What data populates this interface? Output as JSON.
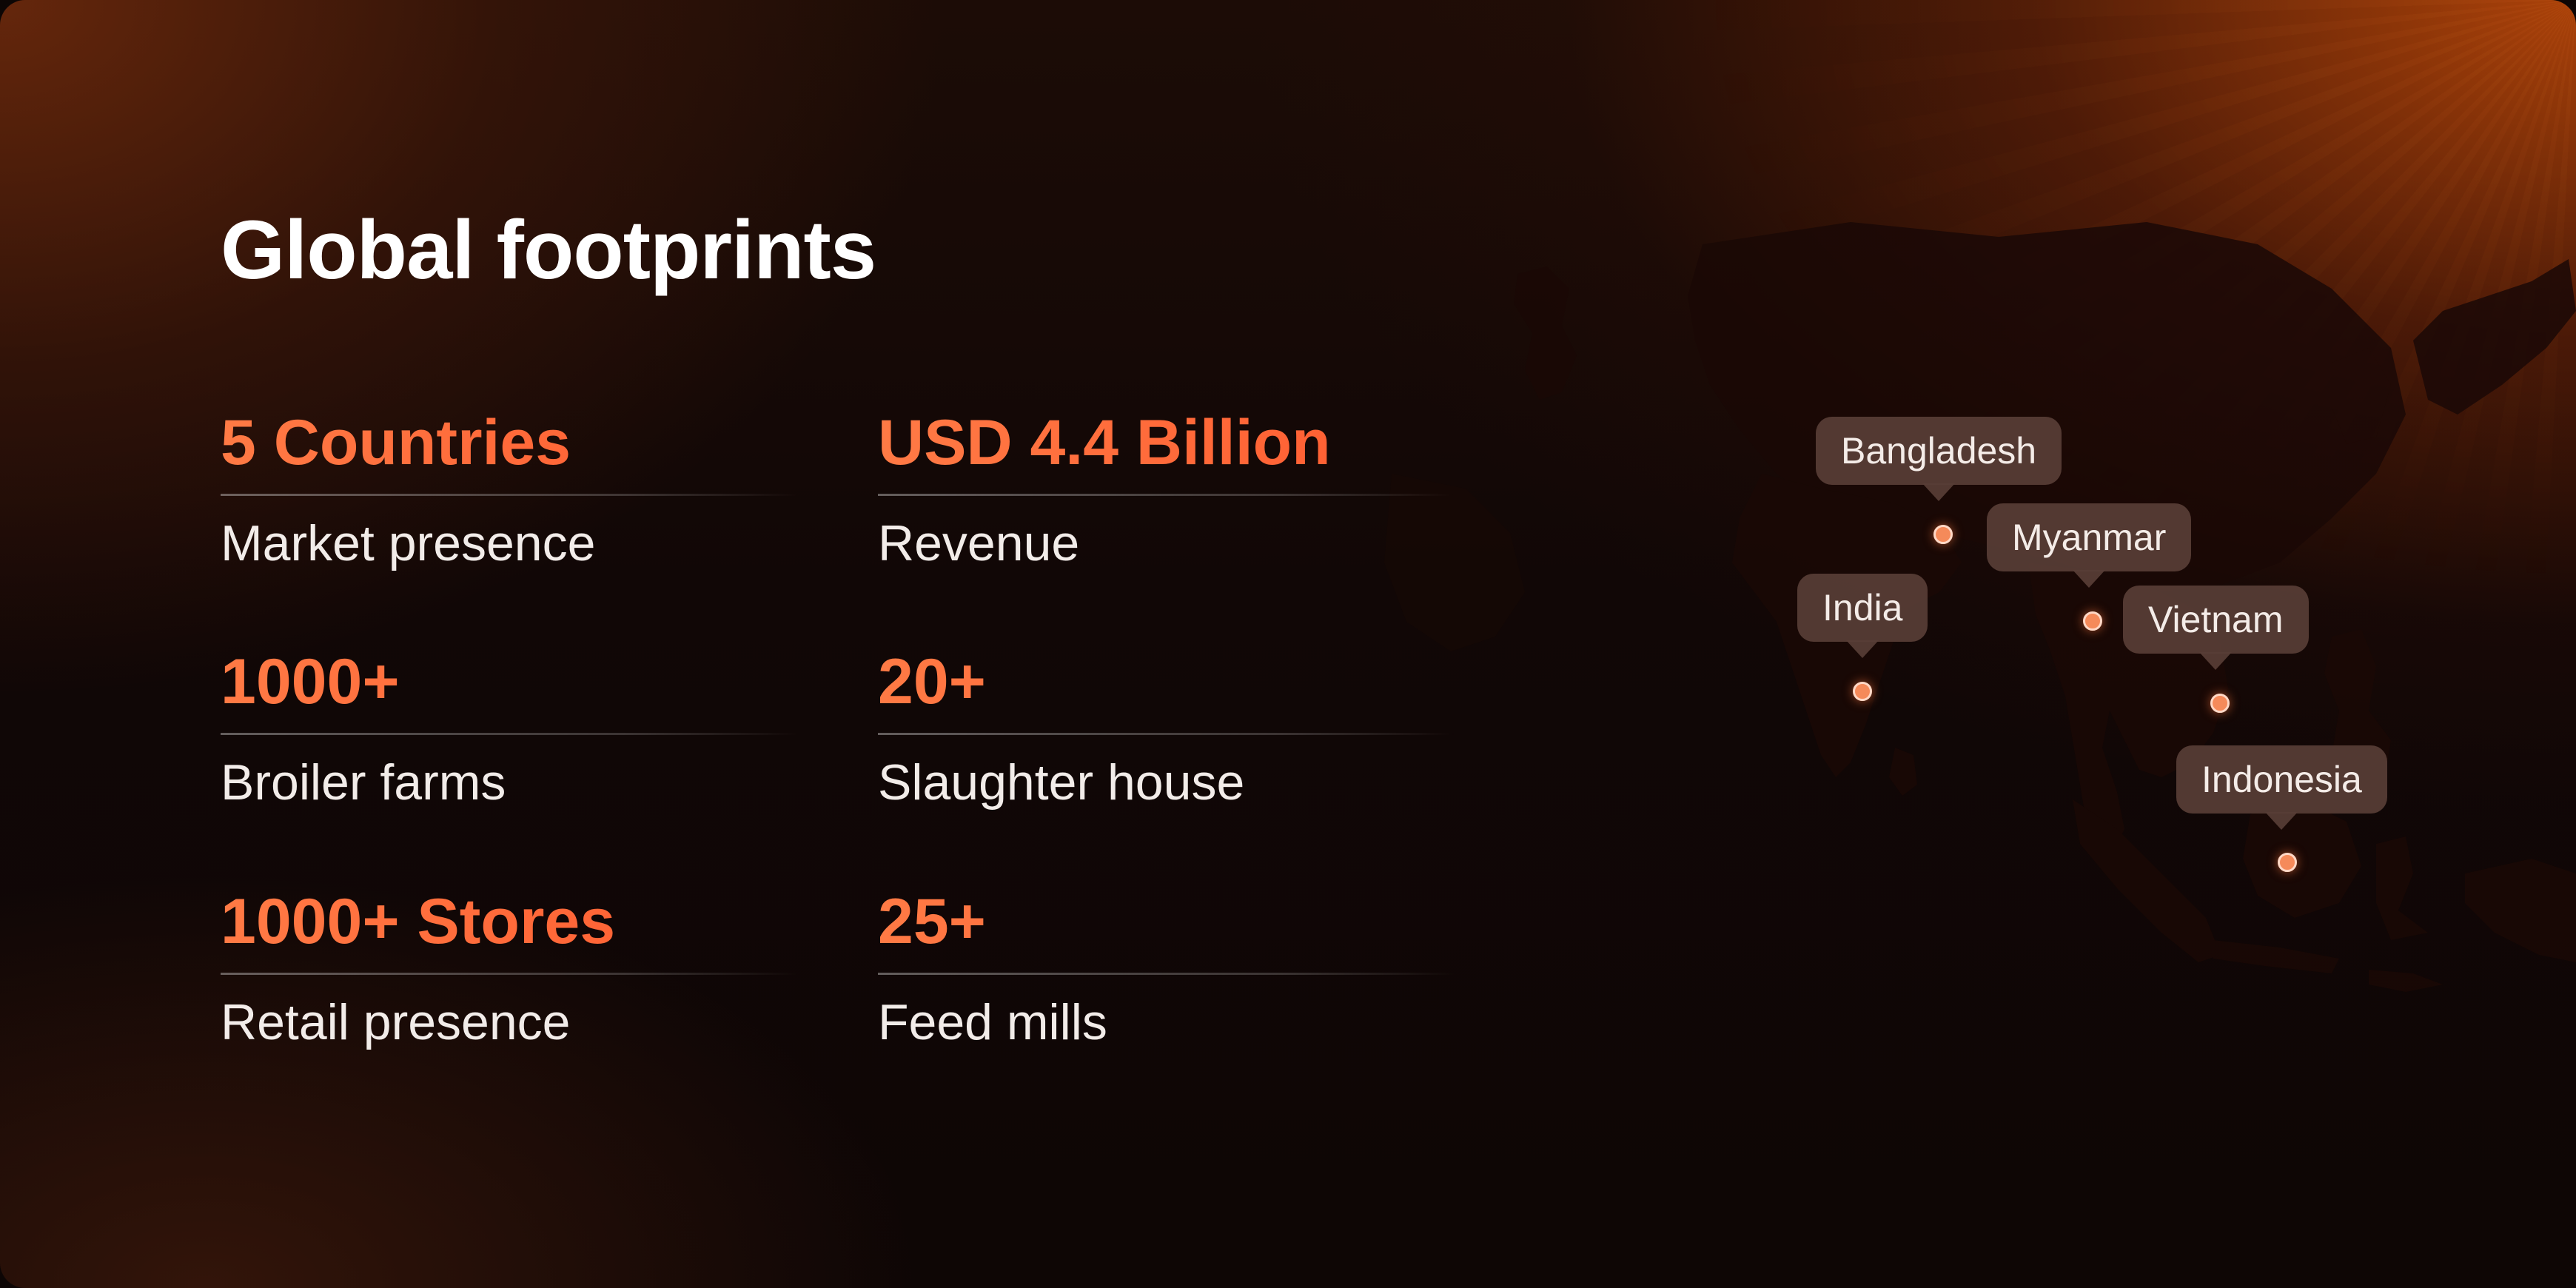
{
  "title": "Global footprints",
  "stats": [
    {
      "value": "5 Countries",
      "label": "Market presence"
    },
    {
      "value": "USD 4.4 Billion",
      "label": "Revenue"
    },
    {
      "value": "1000+",
      "label": "Broiler farms"
    },
    {
      "value": "20+",
      "label": "Slaughter house"
    },
    {
      "value": "1000+ Stores",
      "label": "Retail presence"
    },
    {
      "value": "25+",
      "label": "Feed mills"
    }
  ],
  "map": {
    "markers": [
      {
        "label": "Bangladesh"
      },
      {
        "label": "Myanmar"
      },
      {
        "label": "India"
      },
      {
        "label": "Vietnam"
      },
      {
        "label": "Indonesia"
      }
    ]
  },
  "colors": {
    "accent": "#ff6a3d",
    "marker": "#f58a5a",
    "bubble": "#58403a",
    "text": "#ffffff"
  }
}
